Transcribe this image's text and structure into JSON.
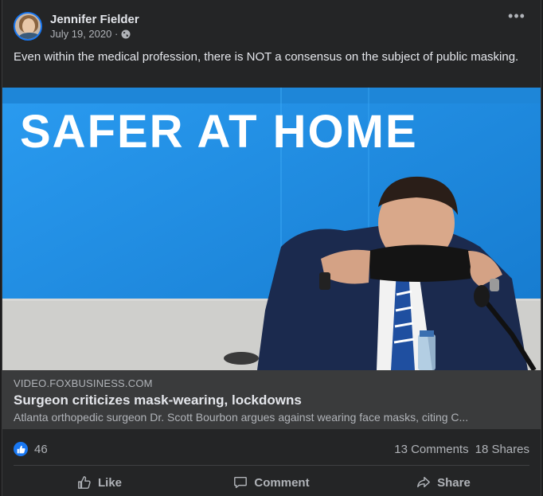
{
  "post": {
    "author": "Jennifer Fielder",
    "date": "July 19, 2020 ·",
    "text": "Even within the medical profession, there is NOT a consensus on the subject of public masking."
  },
  "image": {
    "headline": "SAFER AT HOME"
  },
  "link": {
    "domain": "VIDEO.FOXBUSINESS.COM",
    "title": "Surgeon criticizes mask-wearing, lockdowns",
    "description": "Atlanta orthopedic surgeon Dr. Scott Bourbon argues against wearing face masks, citing C..."
  },
  "stats": {
    "likes": "46",
    "comments": "13 Comments",
    "shares": "18 Shares"
  },
  "actions": {
    "like": "Like",
    "comment": "Comment",
    "share": "Share"
  },
  "icons": {
    "audience": "globe-icon",
    "more": "more-options-icon"
  },
  "colors": {
    "background": "#242526",
    "accent": "#1877f2",
    "link_box": "#3a3b3c"
  }
}
